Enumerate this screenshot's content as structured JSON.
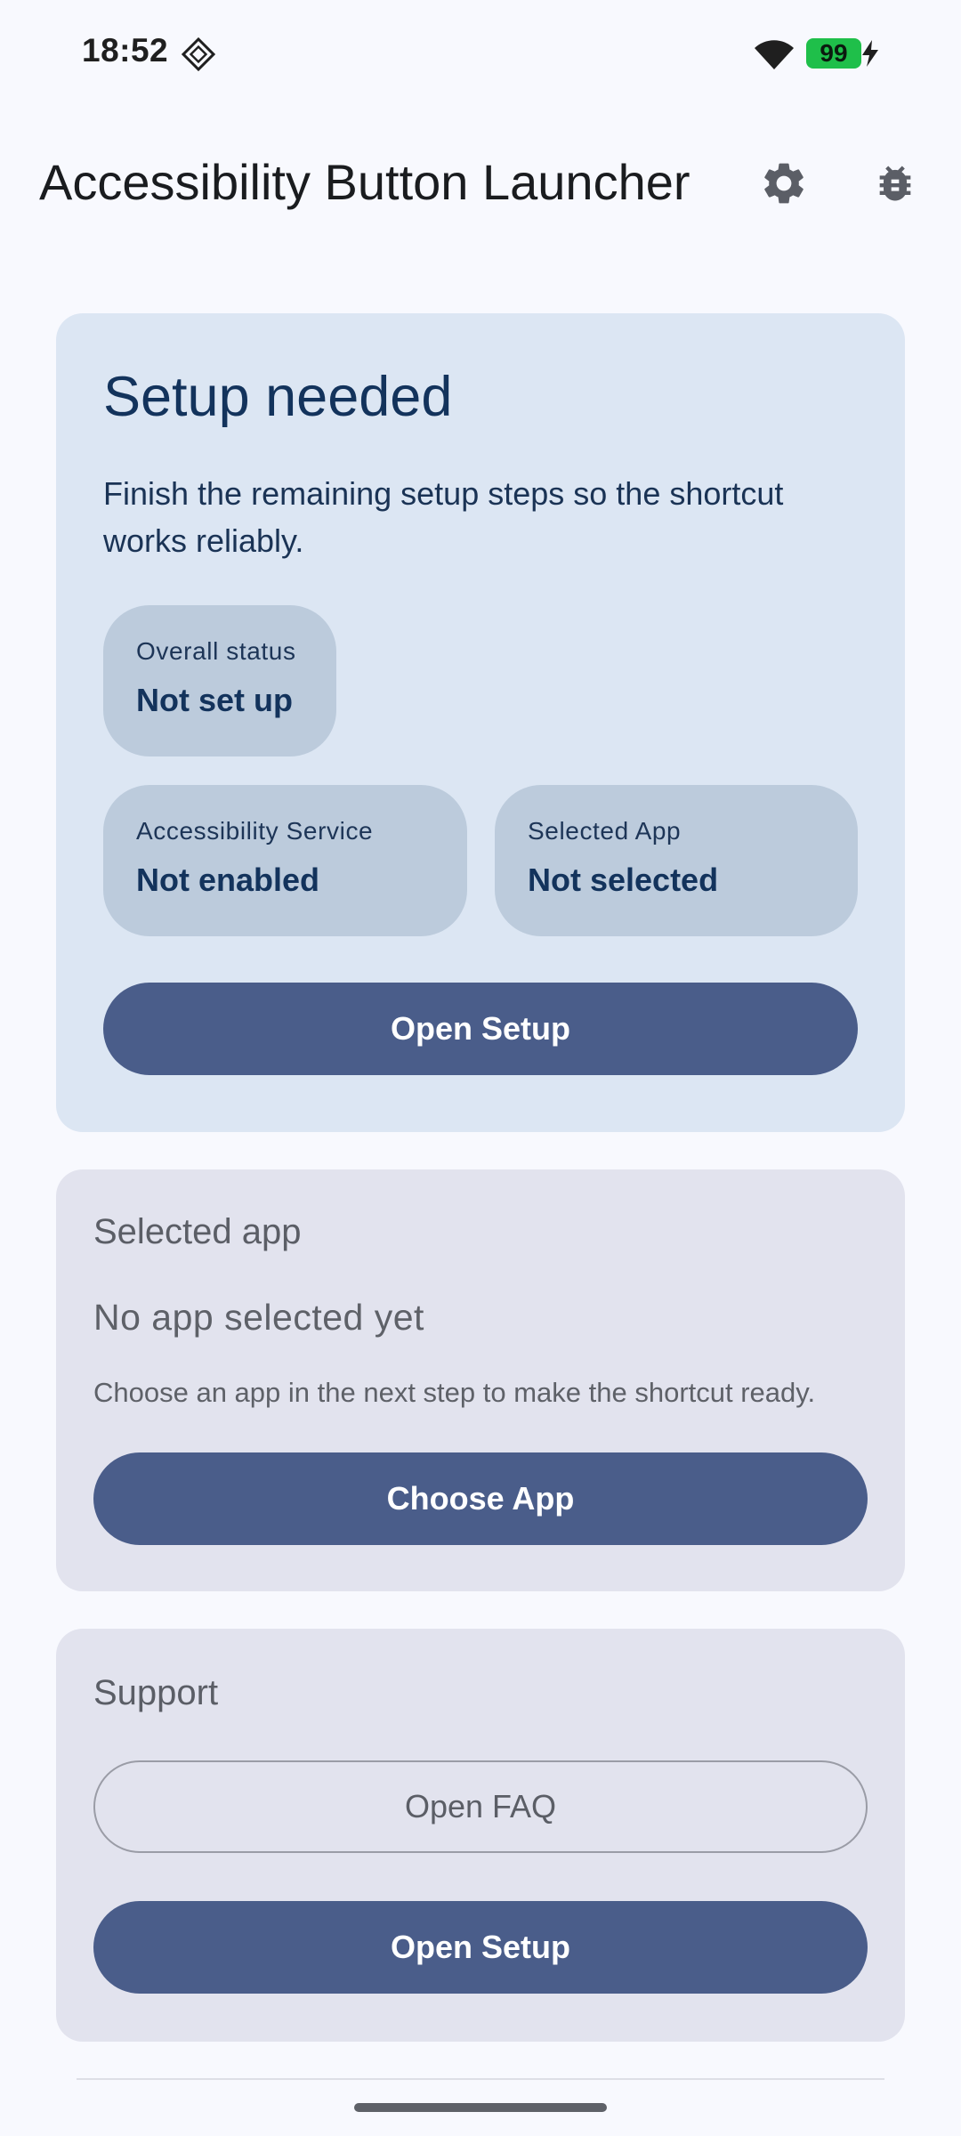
{
  "status_bar": {
    "time": "18:52",
    "battery_level": "99",
    "battery_color": "#1fbf4a",
    "icons": [
      "notification-icon",
      "wifi-icon",
      "battery-icon",
      "charging-bolt-icon"
    ]
  },
  "app_bar": {
    "title": "Accessibility Button Launcher",
    "actions": [
      "settings-icon",
      "bug-icon"
    ]
  },
  "setup_card": {
    "title": "Setup needed",
    "description": "Finish the remaining setup steps so the shortcut works reliably.",
    "overall_status": {
      "label": "Overall status",
      "value": "Not set up"
    },
    "accessibility_service": {
      "label": "Accessibility Service",
      "value": "Not enabled"
    },
    "selected_app": {
      "label": "Selected App",
      "value": "Not selected"
    },
    "button_label": "Open Setup"
  },
  "selected_app_card": {
    "title": "Selected app",
    "empty_text": "No app selected yet",
    "hint": "Choose an app in the next step to make the shortcut ready.",
    "button_label": "Choose App"
  },
  "support_card": {
    "title": "Support",
    "faq_button_label": "Open FAQ",
    "setup_button_label": "Open Setup"
  },
  "colors": {
    "background": "#f8f9fe",
    "setup_card": "#dce6f3",
    "chip": "#bccbdc",
    "primary_button": "#4a5d8a",
    "secondary_card": "#e2e3ee"
  }
}
